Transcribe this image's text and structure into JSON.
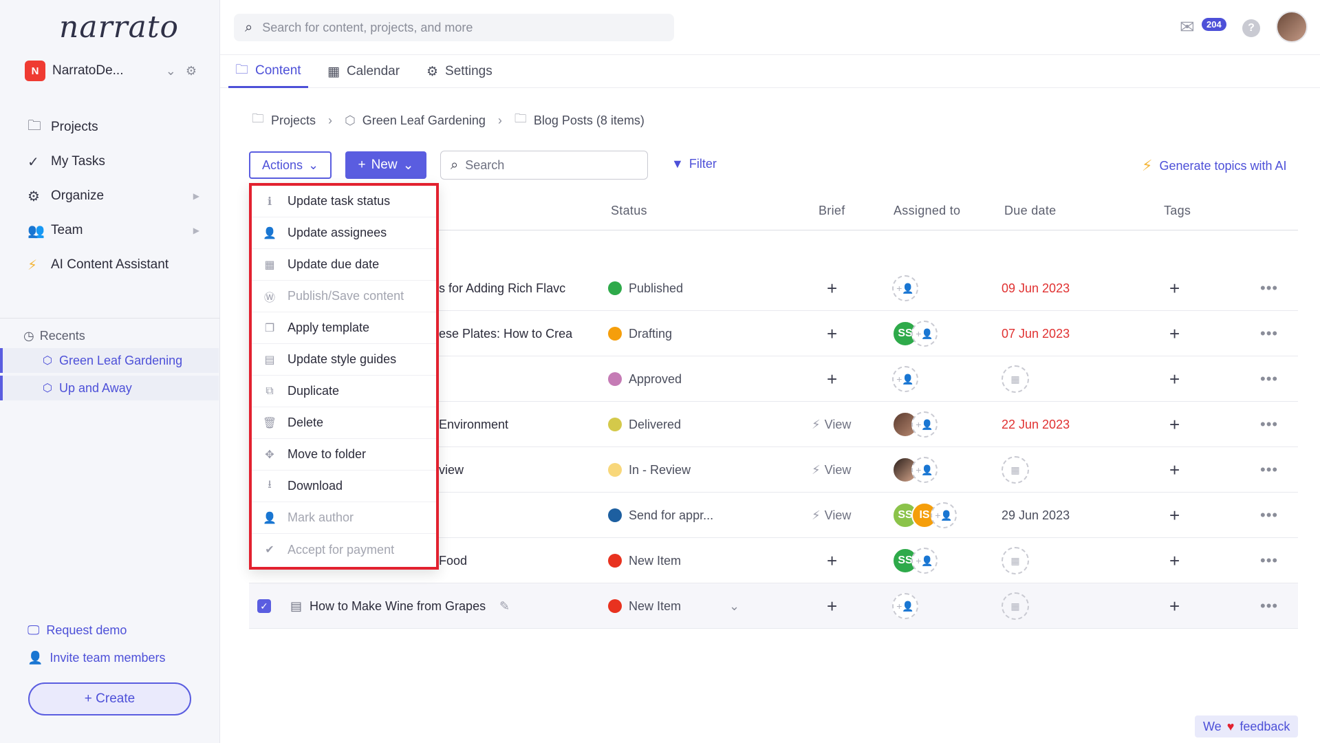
{
  "app": {
    "logo": "narrato"
  },
  "workspace": {
    "badge": "N",
    "name": "NarratoDe..."
  },
  "nav": {
    "items": [
      {
        "label": "Projects",
        "icon": "briefcase-icon",
        "glyph": "🗀"
      },
      {
        "label": "My Tasks",
        "icon": "check-icon",
        "glyph": "✓"
      },
      {
        "label": "Organize",
        "icon": "gears-icon",
        "glyph": "⚙"
      },
      {
        "label": "Team",
        "icon": "team-icon",
        "glyph": "👥"
      },
      {
        "label": "AI Content Assistant",
        "icon": "bolt-icon",
        "glyph": "⚡"
      }
    ]
  },
  "recents": {
    "heading": "Recents",
    "items": [
      "Green Leaf Gardening",
      "Up and Away"
    ]
  },
  "bottom": {
    "request_demo": "Request demo",
    "invite": "Invite team members",
    "create": "+ Create"
  },
  "topbar": {
    "search_placeholder": "Search for content, projects, and more",
    "mail_count": "204",
    "help": "?"
  },
  "tabs": [
    "Content",
    "Calendar",
    "Settings"
  ],
  "breadcrumb": {
    "projects": "Projects",
    "project": "Green Leaf Gardening",
    "folder": "Blog Posts (8 items)"
  },
  "toolbar": {
    "actions": "Actions",
    "new": "New",
    "search_placeholder": "Search",
    "filter": "Filter",
    "generate": "Generate topics with AI"
  },
  "table": {
    "headers": {
      "status": "Status",
      "brief": "Brief",
      "assigned": "Assigned to",
      "due": "Due date",
      "tags": "Tags"
    },
    "rows": [
      {
        "title": "s for Adding Rich Flavc",
        "status": "Published",
        "status_color": "#2eaa4a",
        "brief": "+",
        "due": "09 Jun 2023",
        "due_red": true
      },
      {
        "title": "ese Plates: How to Crea",
        "status": "Drafting",
        "status_color": "#f59e0b",
        "brief": "+",
        "due": "07 Jun 2023",
        "due_red": true
      },
      {
        "title": "",
        "status": "Approved",
        "status_color": "#c57bb5",
        "brief": "+",
        "due": "",
        "due_red": false
      },
      {
        "title": "Environment",
        "status": "Delivered",
        "status_color": "#d4c94a",
        "brief": "View",
        "due": "22 Jun 2023",
        "due_red": true
      },
      {
        "title": "view",
        "status": "In - Review",
        "status_color": "#f8d77a",
        "brief": "View",
        "due": "",
        "due_red": false
      },
      {
        "title": "",
        "status": "Send for appr...",
        "status_color": "#1d5fa0",
        "brief": "View",
        "due": "29 Jun 2023",
        "due_red": false
      },
      {
        "title": "Food",
        "status": "New Item",
        "status_color": "#e8321f",
        "brief": "+",
        "due": "",
        "due_red": false
      },
      {
        "title": "How to Make Wine from Grapes",
        "status": "New Item",
        "status_color": "#e8321f",
        "brief": "+",
        "due": "",
        "due_red": false
      }
    ],
    "avatar_initials": {
      "ss": "SS",
      "is": "IS"
    }
  },
  "actions_menu": [
    {
      "label": "Update task status",
      "icon": "info-icon",
      "glyph": "ℹ",
      "disabled": false
    },
    {
      "label": "Update assignees",
      "icon": "user-icon",
      "glyph": "👤",
      "disabled": false
    },
    {
      "label": "Update due date",
      "icon": "calendar-icon",
      "glyph": "▦",
      "disabled": false
    },
    {
      "label": "Publish/Save content",
      "icon": "wordpress-icon",
      "glyph": "Ⓦ",
      "disabled": true
    },
    {
      "label": "Apply template",
      "icon": "template-icon",
      "glyph": "❐",
      "disabled": false
    },
    {
      "label": "Update style guides",
      "icon": "document-icon",
      "glyph": "▤",
      "disabled": false
    },
    {
      "label": "Duplicate",
      "icon": "copy-icon",
      "glyph": "⧉",
      "disabled": false
    },
    {
      "label": "Delete",
      "icon": "trash-icon",
      "glyph": "🗑",
      "disabled": false
    },
    {
      "label": "Move to folder",
      "icon": "move-icon",
      "glyph": "✥",
      "disabled": false
    },
    {
      "label": "Download",
      "icon": "download-icon",
      "glyph": "⭳",
      "disabled": false
    },
    {
      "label": "Mark author",
      "icon": "user-edit-icon",
      "glyph": "👤",
      "disabled": true
    },
    {
      "label": "Accept for payment",
      "icon": "check-circle-icon",
      "glyph": "✔",
      "disabled": true
    }
  ],
  "feedback": {
    "we": "We",
    "heart": "♥",
    "text": "feedback"
  },
  "colors": {
    "accent": "#5a5de0",
    "highlight": "#e2212f"
  }
}
